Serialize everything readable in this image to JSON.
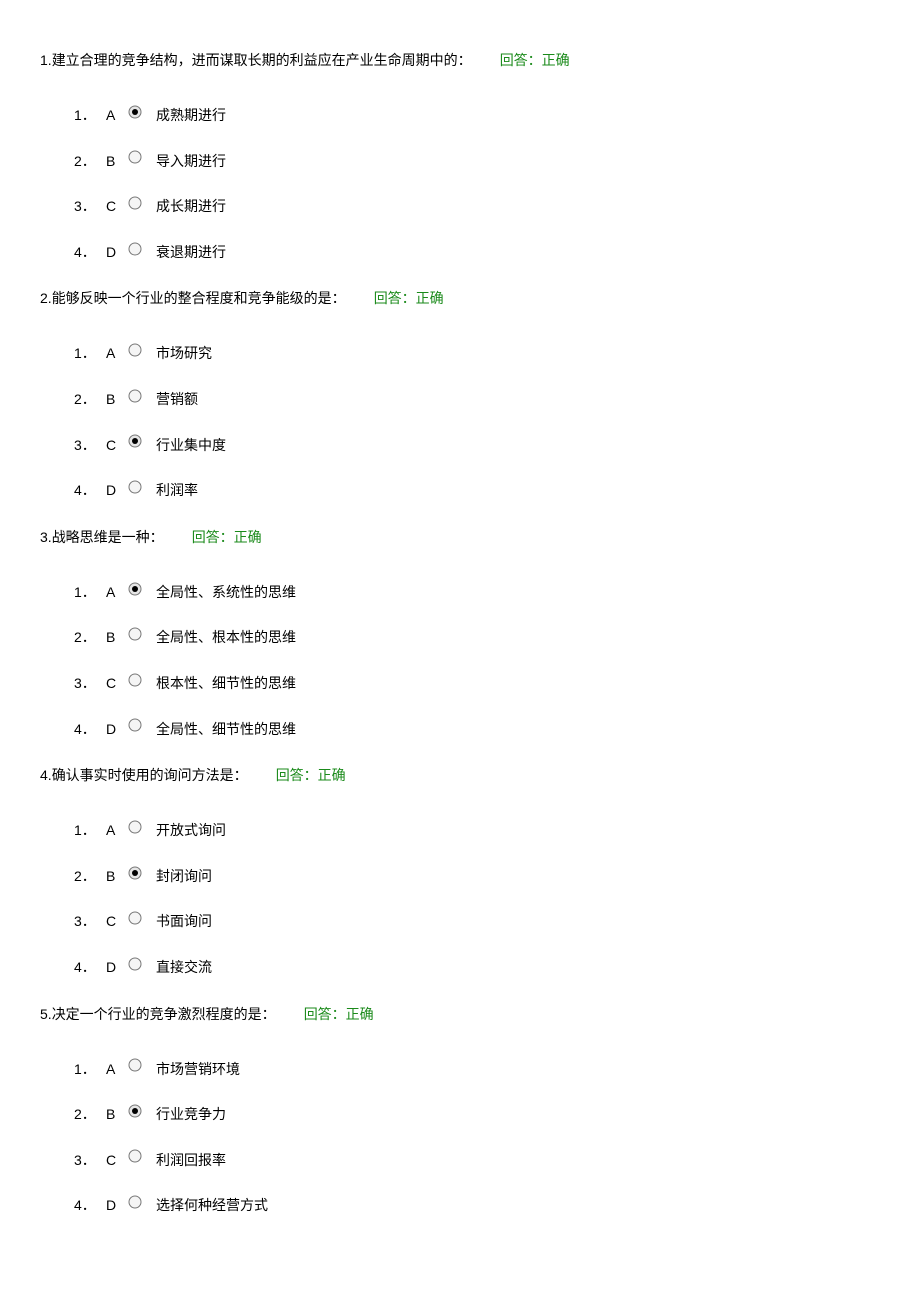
{
  "feedback_label": "回答：正确",
  "questions": [
    {
      "number": "1.",
      "text": "建立合理的竞争结构，进而谋取长期的利益应在产业生命周期中的：",
      "selected": 0,
      "options": [
        {
          "idx": "1．",
          "letter": "A",
          "text": "成熟期进行"
        },
        {
          "idx": "2．",
          "letter": "B",
          "text": "导入期进行"
        },
        {
          "idx": "3．",
          "letter": "C",
          "text": "成长期进行"
        },
        {
          "idx": "4．",
          "letter": "D",
          "text": "衰退期进行"
        }
      ]
    },
    {
      "number": "2.",
      "text": "能够反映一个行业的整合程度和竞争能级的是：",
      "selected": 2,
      "options": [
        {
          "idx": "1．",
          "letter": "A",
          "text": "市场研究"
        },
        {
          "idx": "2．",
          "letter": "B",
          "text": "营销额"
        },
        {
          "idx": "3．",
          "letter": "C",
          "text": "行业集中度"
        },
        {
          "idx": "4．",
          "letter": "D",
          "text": "利润率"
        }
      ]
    },
    {
      "number": "3.",
      "text": "战略思维是一种：",
      "selected": 0,
      "options": [
        {
          "idx": "1．",
          "letter": "A",
          "text": "全局性、系统性的思维"
        },
        {
          "idx": "2．",
          "letter": "B",
          "text": "全局性、根本性的思维"
        },
        {
          "idx": "3．",
          "letter": "C",
          "text": "根本性、细节性的思维"
        },
        {
          "idx": "4．",
          "letter": "D",
          "text": "全局性、细节性的思维"
        }
      ]
    },
    {
      "number": "4.",
      "text": "确认事实时使用的询问方法是：",
      "selected": 1,
      "options": [
        {
          "idx": "1．",
          "letter": "A",
          "text": "开放式询问"
        },
        {
          "idx": "2．",
          "letter": "B",
          "text": "封闭询问"
        },
        {
          "idx": "3．",
          "letter": "C",
          "text": "书面询问"
        },
        {
          "idx": "4．",
          "letter": "D",
          "text": "直接交流"
        }
      ]
    },
    {
      "number": "5.",
      "text": "决定一个行业的竞争激烈程度的是：",
      "selected": 1,
      "options": [
        {
          "idx": "1．",
          "letter": "A",
          "text": "市场营销环境"
        },
        {
          "idx": "2．",
          "letter": "B",
          "text": "行业竞争力"
        },
        {
          "idx": "3．",
          "letter": "C",
          "text": "利润回报率"
        },
        {
          "idx": "4．",
          "letter": "D",
          "text": "选择何种经营方式"
        }
      ]
    }
  ]
}
